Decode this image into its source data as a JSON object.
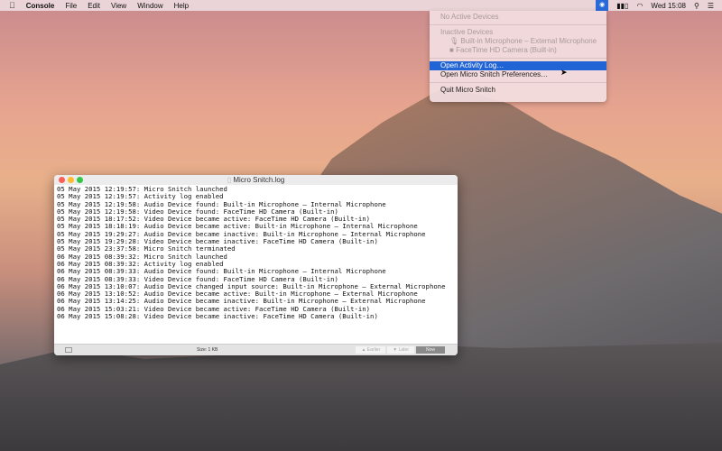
{
  "menubar": {
    "apple": "",
    "app": "Console",
    "items": [
      "File",
      "Edit",
      "View",
      "Window",
      "Help"
    ],
    "clock": "Wed 15:08"
  },
  "menu": {
    "no_active": "No Active Devices",
    "inactive_header": "Inactive Devices",
    "inactive": [
      "Built-in Microphone – External Microphone",
      "FaceTime HD Camera (Built-in)"
    ],
    "open_log": "Open Activity Log…",
    "open_prefs": "Open Micro Snitch Preferences…",
    "quit": "Quit Micro Snitch"
  },
  "window": {
    "title": "Micro Snitch.log",
    "size": "Size: 1 KB",
    "earlier": "Earlier",
    "later": "Later",
    "now": "Now",
    "lines": [
      "05 May 2015 12:19:57: Micro Snitch launched",
      "05 May 2015 12:19:57: Activity log enabled",
      "05 May 2015 12:19:58: Audio Device found: Built-in Microphone – Internal Microphone",
      "05 May 2015 12:19:58: Video Device found: FaceTime HD Camera (Built-in)",
      "05 May 2015 18:17:52: Video Device became active: FaceTime HD Camera (Built-in)",
      "05 May 2015 18:18:19: Audio Device became active: Built-in Microphone – Internal Microphone",
      "05 May 2015 19:29:27: Audio Device became inactive: Built-in Microphone – Internal Microphone",
      "05 May 2015 19:29:28: Video Device became inactive: FaceTime HD Camera (Built-in)",
      "05 May 2015 23:37:58: Micro Snitch terminated",
      "06 May 2015 08:39:32: Micro Snitch launched",
      "06 May 2015 08:39:32: Activity log enabled",
      "06 May 2015 08:39:33: Audio Device found: Built-in Microphone – Internal Microphone",
      "06 May 2015 08:39:33: Video Device found: FaceTime HD Camera (Built-in)",
      "06 May 2015 13:10:07: Audio Device changed input source: Built-in Microphone – External Microphone",
      "06 May 2015 13:10:52: Audio Device became active: Built-in Microphone – External Microphone",
      "06 May 2015 13:14:25: Audio Device became inactive: Built-in Microphone – External Microphone",
      "06 May 2015 15:03:21: Video Device became active: FaceTime HD Camera (Built-in)",
      "06 May 2015 15:08:28: Video Device became inactive: FaceTime HD Camera (Built-in)"
    ]
  }
}
